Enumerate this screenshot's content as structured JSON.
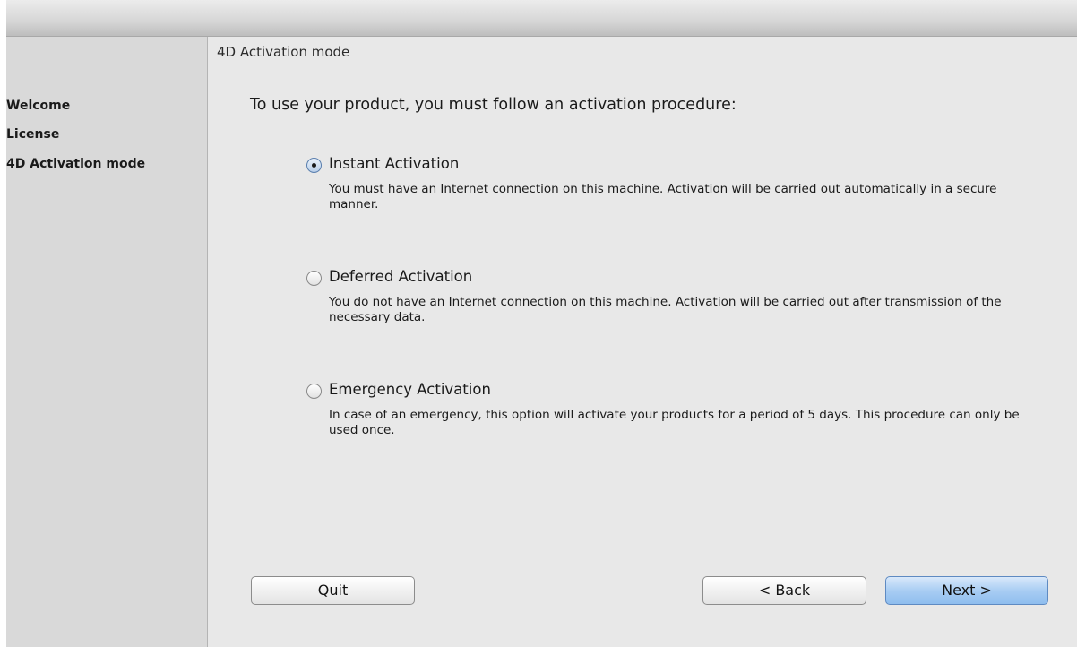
{
  "window": {
    "title": ""
  },
  "sidebar": {
    "items": [
      {
        "label": "Welcome",
        "active": false
      },
      {
        "label": "License",
        "active": false
      },
      {
        "label": "4D Activation mode",
        "active": true
      }
    ]
  },
  "main": {
    "page_title": "4D Activation mode",
    "instructions": "To use your product, you must follow an activation procedure:",
    "options": [
      {
        "label": "Instant Activation",
        "description": "You must have an Internet connection on this machine. Activation will be carried out automatically in a secure manner.",
        "selected": true
      },
      {
        "label": "Deferred Activation",
        "description": "You do not have an Internet connection on this machine. Activation will be carried out after transmission of the necessary data.",
        "selected": false
      },
      {
        "label": "Emergency Activation",
        "description": "In case of an emergency, this option will activate your products for a period of 5 days. This procedure can only be used once.",
        "selected": false
      }
    ]
  },
  "buttons": {
    "quit": "Quit",
    "back": "< Back",
    "next": "Next >"
  },
  "colors": {
    "default_button": "#a9cdf3",
    "sidebar_bg": "#d9d9d9",
    "content_bg": "#e8e8e8"
  }
}
